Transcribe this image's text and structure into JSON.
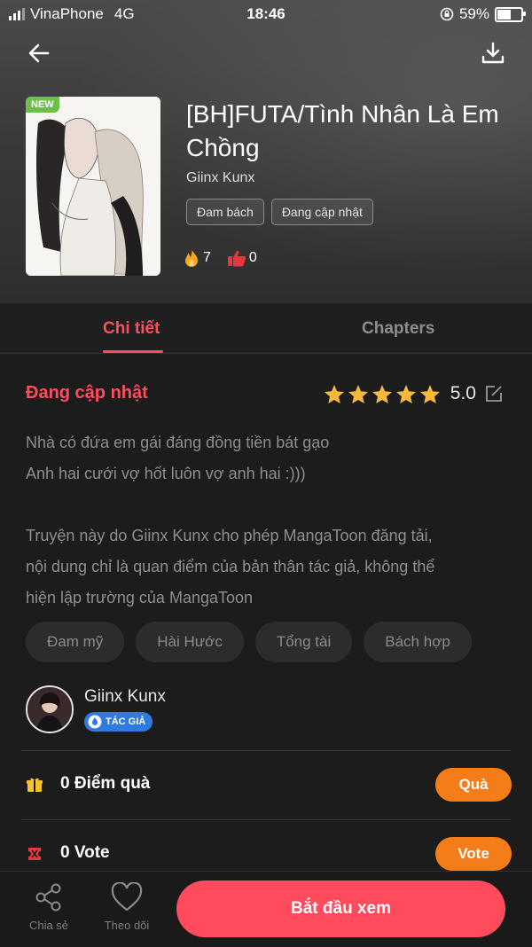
{
  "status_bar": {
    "carrier": "VinaPhone",
    "network": "4G",
    "time": "18:46",
    "battery": "59%"
  },
  "manga": {
    "badge": "NEW",
    "title": "[BH]FUTA/Tình Nhân Là Em Chồng",
    "author": "Giinx Kunx",
    "tags": [
      "Đam bách",
      "Đang cập nhật"
    ],
    "fire_count": "7",
    "like_count": "0"
  },
  "tabs": {
    "details": "Chi tiết",
    "chapters": "Chapters"
  },
  "detail": {
    "status": "Đang cập nhật",
    "rating": "5.0",
    "description_lines": [
      "Nhà có đứa em gái đáng đồng tiền bát gạo",
      "Anh hai cưới vợ hốt luôn vợ anh hai :)))",
      "",
      "Truyện này do Giinx Kunx cho phép MangaToon đăng tải,",
      "nội dung chỉ là quan điểm của bản thân tác giả, không thể",
      "hiện lập trường của MangaToon"
    ],
    "genres": [
      "Đam mỹ",
      "Hài Hước",
      "Tổng tài",
      "Bách hợp"
    ]
  },
  "author_section": {
    "name": "Giinx Kunx",
    "badge": "TÁC GIẢ"
  },
  "rows": {
    "gift": {
      "label": "0 Điểm quà",
      "button": "Quà"
    },
    "vote": {
      "label": "0 Vote",
      "button": "Vote"
    }
  },
  "bottom_bar": {
    "share": "Chia sẻ",
    "follow": "Theo dõi",
    "start": "Bắt đầu xem"
  },
  "colors": {
    "accent": "#ff4d5e",
    "orange": "#f57d19",
    "star": "#f6b93b",
    "badge_new": "#6cc04a",
    "badge_author": "#2f7be0"
  }
}
